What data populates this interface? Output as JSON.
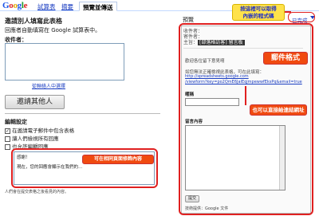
{
  "header": {
    "logo": [
      "G",
      "o",
      "o",
      "g",
      "l",
      "e"
    ],
    "tabs": [
      {
        "label": "試算表"
      },
      {
        "label": "摘要"
      },
      {
        "label": "預覽並傳送"
      }
    ]
  },
  "left": {
    "title": "邀請別人填寫此表格",
    "desc": "回應者自動填寫在 Google 試算表中。",
    "to_label": "收件者：",
    "to_value": "",
    "contact_link": "從聯絡人中選擇",
    "invite_button": "邀請其他人",
    "settings_title": "編輯設定",
    "checkbox_1": "在邀請電子郵件中包含表格",
    "checkbox_2": "讓人們檢視所有回應",
    "checkbox_3": "也允許編輯回應",
    "message_label": "感謝！",
    "message_body": "現在，您的回應會顯示在我們的…",
    "footer_note": "人們會在提交表格之後看見的內容。"
  },
  "right": {
    "preview_label": "預覽",
    "done_link": "已完成",
    "to_line": "收件者：",
    "from_line": "寄件者：",
    "subject_prefix": "主旨：",
    "subject_value": "[部落格訪客] 留言板",
    "intro": "歡迎各位留下意見唷",
    "link_note": "如您無法正確檢視此表格，可在此填寫：",
    "url_1": "http://spreadsheets.google.com",
    "url_2": "/viewform?key=po2QmE6JalEqjmpewwfEksPq&email=true",
    "field_nickname": "暱稱",
    "field_message": "留言內容",
    "submit_label": "提交",
    "footer": "技術提供：Google 文件"
  },
  "annotations": {
    "callout_top": "按這裡可以取得\n內嵌的程式碼",
    "callout_mail": "郵件格式",
    "callout_link": "也可以直接給連結網址",
    "callout_edit": "可在相同頁面修飾內容"
  },
  "colors": {
    "annotation_orange": "#f04a10",
    "annotation_yellow": "#ffe24a",
    "annotation_red": "#e02020",
    "link_blue": "#1a3dc1"
  }
}
